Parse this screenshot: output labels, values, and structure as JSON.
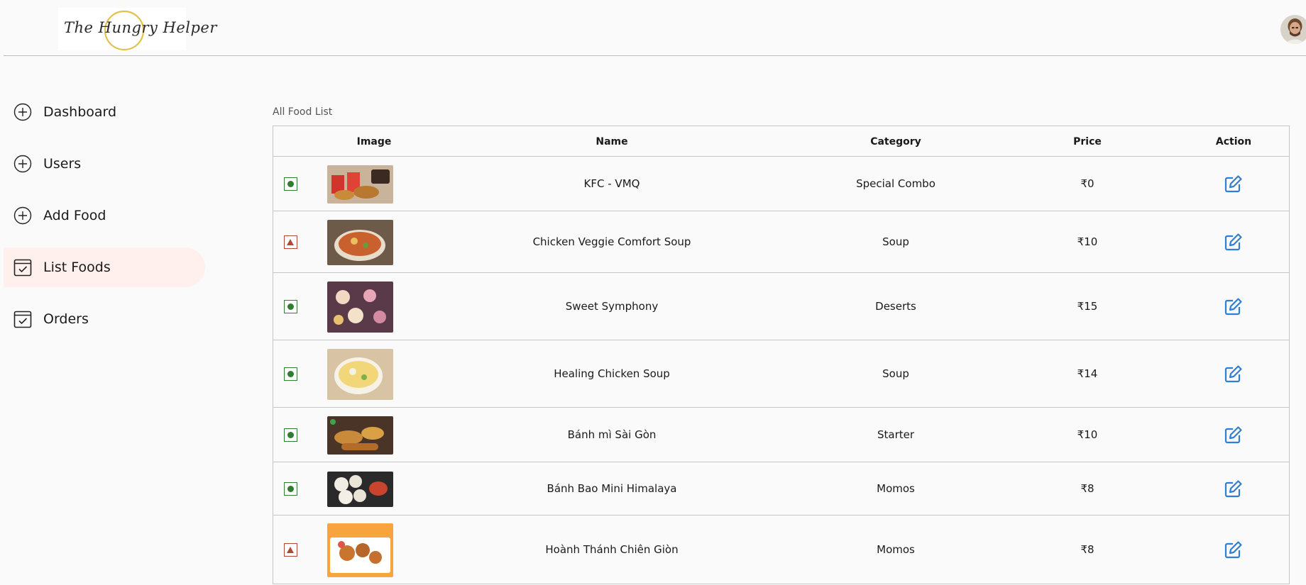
{
  "header": {
    "logo_text": "The Hungry Helper",
    "avatar_icon": "user-avatar"
  },
  "sidebar": {
    "items": [
      {
        "label": "Dashboard",
        "icon": "plus-circle-icon",
        "active": false
      },
      {
        "label": "Users",
        "icon": "plus-circle-icon",
        "active": false
      },
      {
        "label": "Add Food",
        "icon": "plus-circle-icon",
        "active": false
      },
      {
        "label": "List Foods",
        "icon": "checklist-icon",
        "active": true
      },
      {
        "label": "Orders",
        "icon": "checklist-icon",
        "active": false
      }
    ]
  },
  "main": {
    "title": "All Food List",
    "columns": {
      "image": "Image",
      "name": "Name",
      "category": "Category",
      "price": "Price",
      "action": "Action"
    },
    "rows": [
      {
        "type": "veg",
        "name": "KFC - VMQ",
        "category": "Special Combo",
        "price": "₹0"
      },
      {
        "type": "nonveg",
        "name": "Chicken Veggie Comfort Soup",
        "category": "Soup",
        "price": "₹10"
      },
      {
        "type": "veg",
        "name": "Sweet Symphony",
        "category": "Deserts",
        "price": "₹15"
      },
      {
        "type": "veg",
        "name": "Healing Chicken Soup",
        "category": "Soup",
        "price": "₹14"
      },
      {
        "type": "veg",
        "name": "Bánh mì Sài Gòn",
        "category": "Starter",
        "price": "₹10"
      },
      {
        "type": "veg",
        "name": "Bánh Bao Mini Himalaya",
        "category": "Momos",
        "price": "₹8"
      },
      {
        "type": "nonveg",
        "name": "Hoành Thánh Chiên Giòn",
        "category": "Momos",
        "price": "₹8"
      }
    ]
  },
  "colors": {
    "active_nav_bg": "#fff0ed",
    "veg_green": "#2e7d32",
    "nonveg_brown": "#b04a36",
    "edit_blue": "#2f7fd6"
  }
}
